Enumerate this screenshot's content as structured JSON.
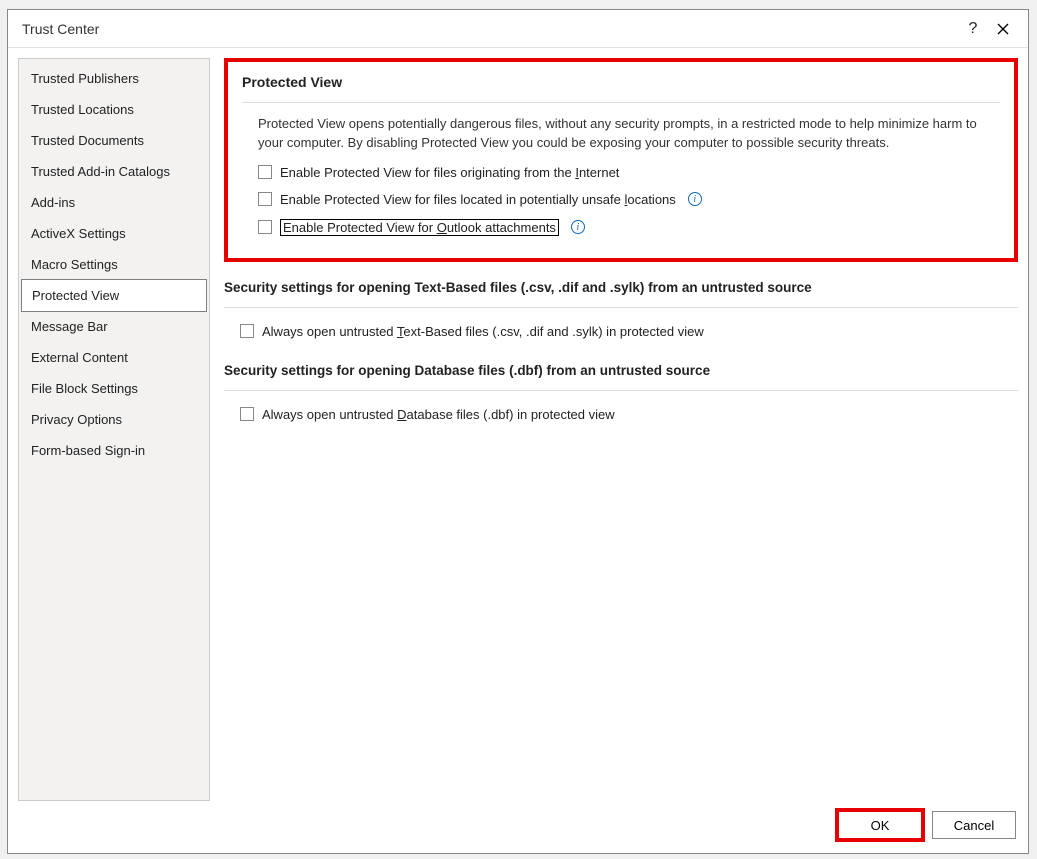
{
  "dialog": {
    "title": "Trust Center"
  },
  "sidebar": {
    "items": [
      {
        "label": "Trusted Publishers"
      },
      {
        "label": "Trusted Locations"
      },
      {
        "label": "Trusted Documents"
      },
      {
        "label": "Trusted Add-in Catalogs"
      },
      {
        "label": "Add-ins"
      },
      {
        "label": "ActiveX Settings"
      },
      {
        "label": "Macro Settings"
      },
      {
        "label": "Protected View"
      },
      {
        "label": "Message Bar"
      },
      {
        "label": "External Content"
      },
      {
        "label": "File Block Settings"
      },
      {
        "label": "Privacy Options"
      },
      {
        "label": "Form-based Sign-in"
      }
    ]
  },
  "protectedView": {
    "title": "Protected View",
    "description": "Protected View opens potentially dangerous files, without any security prompts, in a restricted mode to help minimize harm to your computer. By disabling Protected View you could be exposing your computer to possible security threats.",
    "opt1_pre": "Enable Protected View for files originating from the ",
    "opt1_u": "I",
    "opt1_post": "nternet",
    "opt2_pre": "Enable Protected View for files located in potentially unsafe ",
    "opt2_u": "l",
    "opt2_post": "ocations",
    "opt3_pre": "Enable Protected View for ",
    "opt3_u": "O",
    "opt3_post": "utlook attachments"
  },
  "textBased": {
    "title": "Security settings for opening Text-Based files (.csv, .dif and .sylk) from an untrusted source",
    "opt_pre": "Always open untrusted ",
    "opt_u": "T",
    "opt_post": "ext-Based files (.csv, .dif and .sylk) in protected view"
  },
  "database": {
    "title": "Security settings for opening Database files (.dbf) from an untrusted source",
    "opt_pre": "Always open untrusted ",
    "opt_u": "D",
    "opt_post": "atabase files (.dbf) in protected view"
  },
  "footer": {
    "ok": "OK",
    "cancel": "Cancel"
  }
}
